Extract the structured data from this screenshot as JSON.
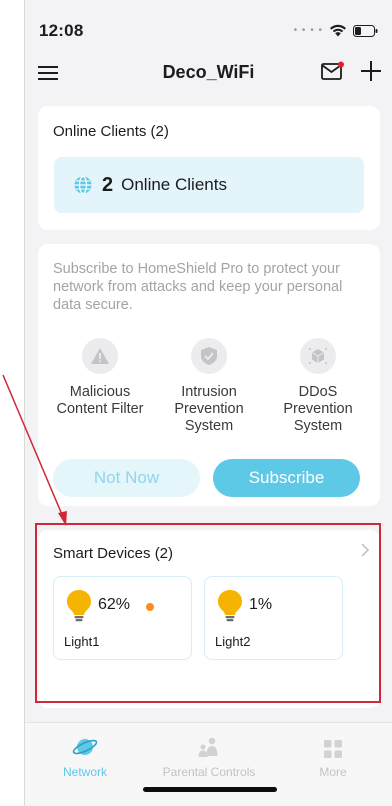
{
  "status_bar": {
    "time": "12:08"
  },
  "nav": {
    "title": "Deco_WiFi"
  },
  "online_clients": {
    "title": "Online Clients (2)",
    "count": "2",
    "label": "Online Clients"
  },
  "homeshield": {
    "description": "Subscribe to HomeShield Pro to protect your network from attacks and keep your personal data secure.",
    "features": [
      {
        "icon": "warning-triangle-icon",
        "label": "Malicious Content Filter"
      },
      {
        "icon": "shield-check-icon",
        "label": "Intrusion Prevention System"
      },
      {
        "icon": "ddos-cube-icon",
        "label": "DDoS Prevention System"
      }
    ],
    "not_now_label": "Not Now",
    "subscribe_label": "Subscribe"
  },
  "smart_devices": {
    "title": "Smart Devices (2)",
    "devices": [
      {
        "value": "62%",
        "name": "Light1",
        "status_color": "#ff8c1a"
      },
      {
        "value": "1%",
        "name": "Light2"
      }
    ]
  },
  "tabbar": {
    "tabs": [
      {
        "label": "Network",
        "icon": "planet-icon",
        "active": true
      },
      {
        "label": "Parental Controls",
        "icon": "family-icon",
        "active": false
      },
      {
        "label": "More",
        "icon": "grid-icon",
        "active": false
      }
    ]
  },
  "colors": {
    "accent": "#5ec8e7",
    "annotation": "#d0283b",
    "bulb": "#f6b400"
  }
}
